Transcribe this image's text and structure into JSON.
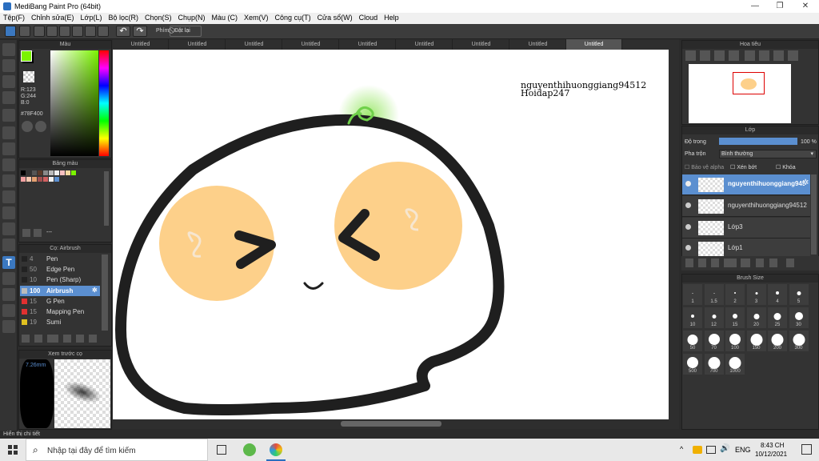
{
  "window": {
    "title": "MediBang Paint Pro (64bit)",
    "minimize": "—",
    "restore": "❐",
    "close": "✕"
  },
  "menu": [
    "Tệp(F)",
    "Chỉnh sửa(E)",
    "Lớp(L)",
    "Bộ lọc(R)",
    "Chọn(S)",
    "Chụp(N)",
    "Màu (C)",
    "Xem(V)",
    "Công cụ(T)",
    "Cửa sổ(W)",
    "Cloud",
    "Help"
  ],
  "toolbar": {
    "phim_label": "Phím",
    "reset_label": "Đặt lại"
  },
  "tabs": [
    "Untitled",
    "Untitled",
    "Untitled",
    "Untitled",
    "Untitled",
    "Untitled",
    "Untitled",
    "Untitled",
    "Untitled"
  ],
  "color_panel": {
    "title": "Màu",
    "r": "R:123",
    "g": "G:244",
    "b": "B:0",
    "hex": "#78F400",
    "fg": "#7bf400",
    "bg": "#000000"
  },
  "palette_panel": {
    "title": "Bảng màu",
    "value": "---"
  },
  "brush_panel": {
    "title": "Cọ: Airbrush",
    "items": [
      {
        "size": "4",
        "name": "Pen",
        "color": "#222222"
      },
      {
        "size": "50",
        "name": "Edge Pen",
        "color": "#222222"
      },
      {
        "size": "10",
        "name": "Pen (Sharp)",
        "color": "#222222"
      },
      {
        "size": "100",
        "name": "Airbrush",
        "color": "#bbbbbb"
      },
      {
        "size": "15",
        "name": "G Pen",
        "color": "#e03030"
      },
      {
        "size": "15",
        "name": "Mapping Pen",
        "color": "#e03030"
      },
      {
        "size": "19",
        "name": "Sumi",
        "color": "#e0c020"
      }
    ]
  },
  "preview_panel": {
    "title": "Xem trước cọ",
    "size": "7.26mm"
  },
  "navigator": {
    "title": "Hoa tiêu"
  },
  "layer_panel": {
    "title": "Lớp",
    "opacity_label": "Độ trong",
    "opacity_value": "100 %",
    "blend_label": "Pha trộn",
    "blend_value": "Bình thường",
    "protect_alpha": "Bảo vệ alpha",
    "clipping": "Xén bớt",
    "lock": "Khóa",
    "layers": [
      "nguyenthihuonggiang94512",
      "nguyenthihuonggiang94512",
      "Lớp3",
      "Lớp1"
    ]
  },
  "brush_size": {
    "title": "Brush Size",
    "sizes": [
      "1",
      "1.5",
      "2",
      "3",
      "4",
      "5",
      "10",
      "12",
      "15",
      "20",
      "25",
      "30",
      "50",
      "70",
      "100",
      "150",
      "200",
      "300",
      "500",
      "700",
      "1000"
    ]
  },
  "canvas_text": {
    "line1": "nguyenthihuonggiang94512",
    "line2": "Hoidap247"
  },
  "status": "Hiển thị chi tiết",
  "taskbar": {
    "search_placeholder": "Nhập tại đây để tìm kiếm",
    "lang": "ENG",
    "time": "8:43 CH",
    "date": "10/12/2021"
  },
  "colors": {
    "accent": "#5b8fd0",
    "orange": "#fdd08a",
    "stroke": "#1f1f1f",
    "sprout": "#7ed957"
  }
}
